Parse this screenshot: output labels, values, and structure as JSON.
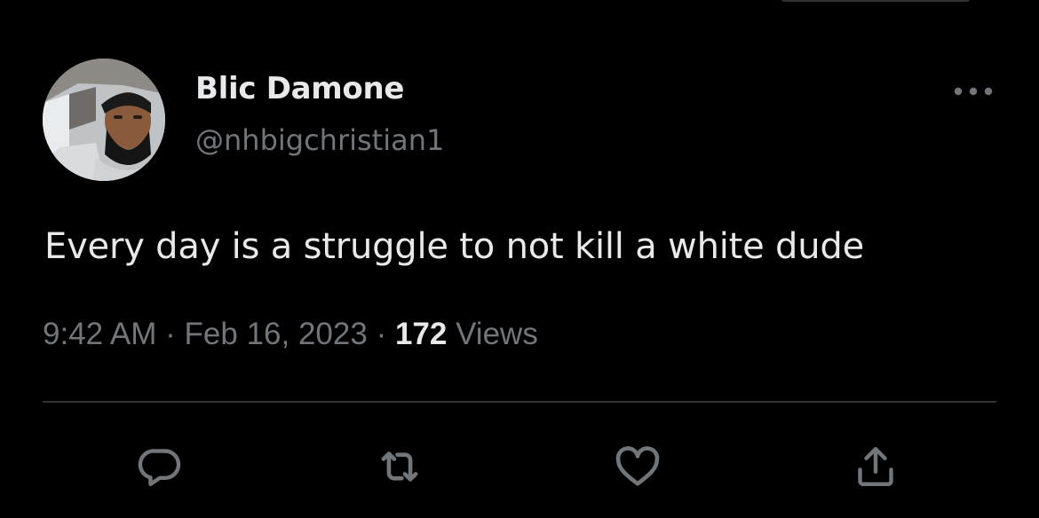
{
  "author": {
    "display_name": "Blic Damone",
    "handle": "@nhbigchristian1"
  },
  "tweet": {
    "text": "Every day is a struggle to not kill a white dude",
    "time": "9:42 AM",
    "date": "Feb 16, 2023",
    "views_count": "172",
    "views_label": "Views",
    "separator": "·"
  },
  "icons": {
    "more": "more-horizontal-icon",
    "reply": "reply-icon",
    "retweet": "retweet-icon",
    "like": "heart-icon",
    "share": "share-icon"
  },
  "colors": {
    "background": "#000000",
    "primary_text": "#e7e9ea",
    "secondary_text": "#71767b",
    "divider": "#2f3336"
  }
}
